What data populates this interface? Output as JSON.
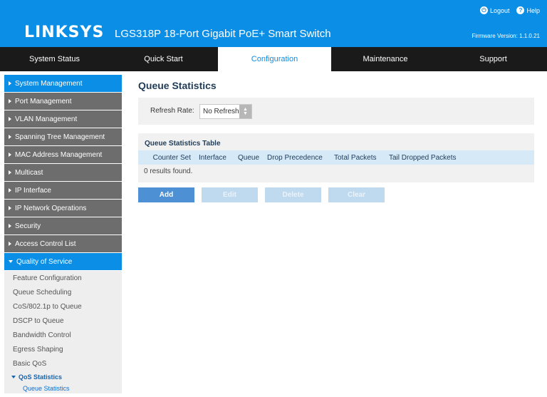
{
  "header": {
    "logo": "LINKSYS",
    "product": "LGS318P 18-Port Gigabit PoE+ Smart Switch",
    "logout_label": "Logout",
    "help_label": "Help",
    "firmware": "Firmware Version: 1.1.0.21",
    "color": "#0b8ee6"
  },
  "nav": {
    "tabs": [
      "System Status",
      "Quick Start",
      "Configuration",
      "Maintenance",
      "Support"
    ],
    "active": "Configuration"
  },
  "sidebar": {
    "items": [
      "System Management",
      "Port Management",
      "VLAN Management",
      "Spanning Tree Management",
      "MAC Address Management",
      "Multicast",
      "IP Interface",
      "IP Network Operations",
      "Security",
      "Access Control List",
      "Quality of Service"
    ],
    "active": "Quality of Service",
    "qos_sub": [
      "Feature Configuration",
      "Queue Scheduling",
      "CoS/802.1p to Queue",
      "DSCP to Queue",
      "Bandwidth Control",
      "Egress Shaping",
      "Basic QoS"
    ],
    "qos_stats_group": "QoS Statistics",
    "qos_stats_sub": [
      "Queue Statistics"
    ]
  },
  "main": {
    "title": "Queue Statistics",
    "refresh_label": "Refresh Rate:",
    "refresh_value": "No Refresh",
    "table_title": "Queue Statistics Table",
    "columns": [
      "Counter Set",
      "Interface",
      "Queue",
      "Drop Precedence",
      "Total Packets",
      "Tail Dropped Packets"
    ],
    "empty_text": "0 results found.",
    "buttons": {
      "add": "Add",
      "edit": "Edit",
      "delete": "Delete",
      "clear": "Clear"
    }
  }
}
